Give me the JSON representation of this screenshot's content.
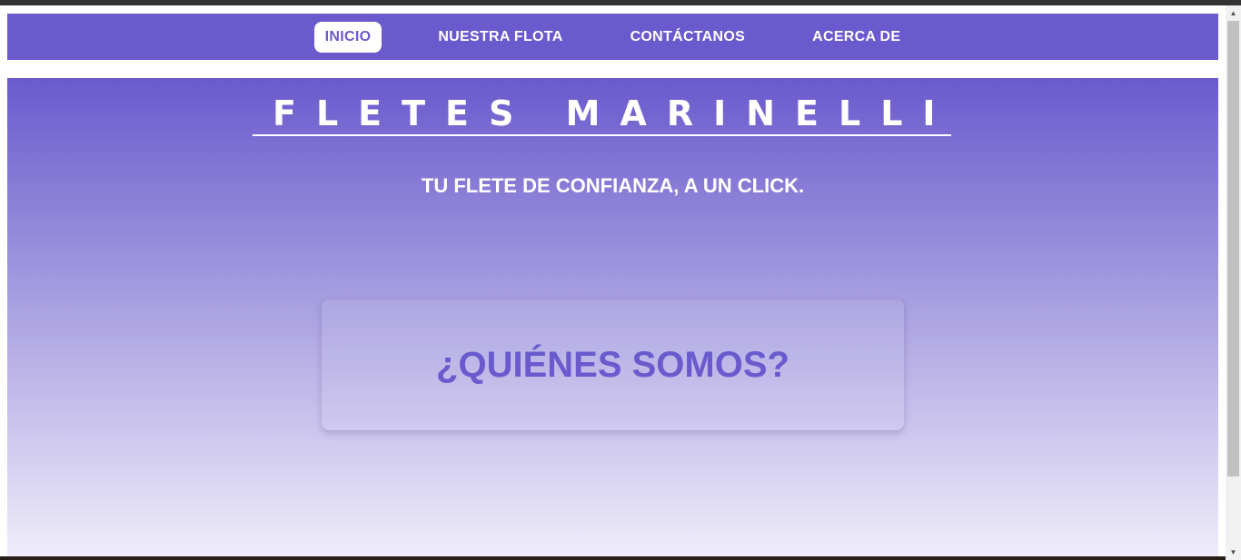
{
  "nav": {
    "items": [
      {
        "label": "INICIO",
        "active": true
      },
      {
        "label": "NUESTRA FLOTA",
        "active": false
      },
      {
        "label": "CONTÁCTANOS",
        "active": false
      },
      {
        "label": "ACERCA DE",
        "active": false
      }
    ]
  },
  "hero": {
    "title": "FLETES MARINELLI",
    "tagline": "TU FLETE DE CONFIANZA, A UN CLICK.",
    "about_heading": "¿QUIÉNES SOMOS?"
  },
  "colors": {
    "accent": "#6a5acd",
    "text_light": "#ffffff"
  },
  "icons": {
    "scroll_up": "scroll-up-arrow-icon",
    "scroll_down": "scroll-down-arrow-icon"
  }
}
